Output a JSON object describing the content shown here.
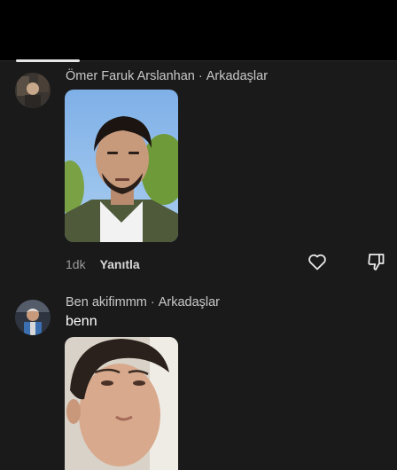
{
  "comments": [
    {
      "author": "Ömer Faruk Arslanhan",
      "separator": "·",
      "relation": "Arkadaşlar",
      "time": "1dk",
      "reply_label": "Yanıtla"
    },
    {
      "author": "Ben akifimmm",
      "separator": "·",
      "relation": "Arkadaşlar",
      "text": "benn"
    }
  ],
  "icons": {
    "like": "heart-icon",
    "dislike": "thumbs-down-icon"
  },
  "colors": {
    "background": "#1a1a1a",
    "topbar": "#000000",
    "meta_text": "#c9c9c9"
  }
}
